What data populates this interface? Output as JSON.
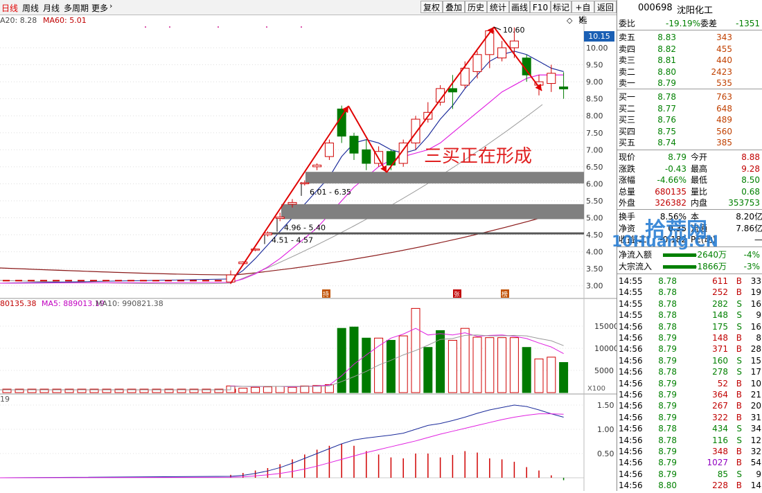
{
  "toolbar": {
    "periods": [
      "日线",
      "周线",
      "月线",
      "多周期",
      "更多"
    ],
    "buttons": [
      "复权",
      "叠加",
      "历史",
      "统计",
      "画线",
      "F10",
      "标记",
      "+自选",
      "返回"
    ]
  },
  "header": {
    "code": "000698",
    "name": "沈阳化工"
  },
  "main_chart": {
    "ma_legend": [
      {
        "text": "A20: 8.28",
        "color": "#4a4a4a"
      },
      {
        "text": "MA60: 5.01",
        "color": "#c00000"
      }
    ],
    "price_box": "10.15",
    "y_ticks": [
      "10.00",
      "9.50",
      "9.00",
      "8.50",
      "8.00",
      "7.50",
      "7.00",
      "6.50",
      "6.00",
      "5.50",
      "5.00",
      "4.50",
      "4.00",
      "3.50",
      "3.00"
    ],
    "peak_label": "10.60",
    "zones": [
      "6.01 - 6.35",
      "4.96 - 5.40",
      "4.51 - 4.57"
    ],
    "annotation": "三买正在形成",
    "markers": [
      "持",
      "张",
      "榜"
    ]
  },
  "vol_chart": {
    "legend": [
      {
        "text": "80135.38",
        "color": "#c00000"
      },
      {
        "text": "MA5: 889013.19",
        "color": "#c000c0"
      },
      {
        "text": "MA10: 990821.38",
        "color": "#555555"
      }
    ],
    "y_ticks": [
      "15000",
      "10000",
      "5000"
    ],
    "scale": "X100"
  },
  "macd_chart": {
    "legend": "19",
    "y_ticks": [
      "1.50",
      "1.00",
      "0.50"
    ]
  },
  "quote": {
    "wei_bi": {
      "label": "委比",
      "value": "-19.19%"
    },
    "wei_cha": {
      "label": "委差",
      "value": "-1351"
    },
    "asks": [
      {
        "label": "卖五",
        "price": "8.83",
        "vol": "343"
      },
      {
        "label": "卖四",
        "price": "8.82",
        "vol": "455"
      },
      {
        "label": "卖三",
        "price": "8.81",
        "vol": "440"
      },
      {
        "label": "卖二",
        "price": "8.80",
        "vol": "2423"
      },
      {
        "label": "卖一",
        "price": "8.79",
        "vol": "535"
      }
    ],
    "bids": [
      {
        "label": "买一",
        "price": "8.78",
        "vol": "763"
      },
      {
        "label": "买二",
        "price": "8.77",
        "vol": "648"
      },
      {
        "label": "买三",
        "price": "8.76",
        "vol": "489"
      },
      {
        "label": "买四",
        "price": "8.75",
        "vol": "560"
      },
      {
        "label": "买五",
        "price": "8.74",
        "vol": "385"
      }
    ],
    "stats": [
      {
        "l1": "现价",
        "v1": "8.79",
        "l2": "今开",
        "v2": "8.88",
        "c1": "#008000",
        "c2": "#c00000"
      },
      {
        "l1": "涨跌",
        "v1": "-0.43",
        "l2": "最高",
        "v2": "9.28",
        "c1": "#008000",
        "c2": "#c00000"
      },
      {
        "l1": "涨幅",
        "v1": "-4.66%",
        "l2": "最低",
        "v2": "8.50",
        "c1": "#008000",
        "c2": "#008000"
      },
      {
        "l1": "总量",
        "v1": "680135",
        "l2": "量比",
        "v2": "0.68",
        "c1": "#c00000",
        "c2": "#008000"
      },
      {
        "l1": "外盘",
        "v1": "326382",
        "l2": "内盘",
        "v2": "353753",
        "c1": "#c00000",
        "c2": "#008000"
      }
    ],
    "stats2": [
      {
        "l1": "换手",
        "v1": "8.56%",
        "l2": "本",
        "v2": "8.20亿"
      },
      {
        "l1": "净资",
        "v1": "0.35",
        "l2": "流通",
        "v2": "7.86亿"
      },
      {
        "l1": "收益(二)",
        "v1": "-0.182",
        "l2": "PE(动)",
        "v2": "—"
      }
    ],
    "flows": [
      {
        "label": "净流入额",
        "value": "-2640万",
        "pct": "-4%"
      },
      {
        "label": "大宗流入",
        "value": "-1866万",
        "pct": "-3%"
      }
    ]
  },
  "ticks": [
    {
      "t": "14:55",
      "p": "8.78",
      "v": "611",
      "d": "B",
      "n": "33"
    },
    {
      "t": "14:55",
      "p": "8.78",
      "v": "252",
      "d": "B",
      "n": "19"
    },
    {
      "t": "14:55",
      "p": "8.78",
      "v": "282",
      "d": "S",
      "n": "16"
    },
    {
      "t": "14:55",
      "p": "8.78",
      "v": "148",
      "d": "S",
      "n": "9"
    },
    {
      "t": "14:56",
      "p": "8.78",
      "v": "175",
      "d": "S",
      "n": "16"
    },
    {
      "t": "14:56",
      "p": "8.79",
      "v": "148",
      "d": "B",
      "n": "8"
    },
    {
      "t": "14:56",
      "p": "8.79",
      "v": "371",
      "d": "B",
      "n": "28"
    },
    {
      "t": "14:56",
      "p": "8.79",
      "v": "160",
      "d": "S",
      "n": "15"
    },
    {
      "t": "14:56",
      "p": "8.78",
      "v": "278",
      "d": "S",
      "n": "17"
    },
    {
      "t": "14:56",
      "p": "8.79",
      "v": "52",
      "d": "B",
      "n": "10"
    },
    {
      "t": "14:56",
      "p": "8.79",
      "v": "364",
      "d": "B",
      "n": "21"
    },
    {
      "t": "14:56",
      "p": "8.79",
      "v": "267",
      "d": "B",
      "n": "20"
    },
    {
      "t": "14:56",
      "p": "8.79",
      "v": "322",
      "d": "B",
      "n": "31"
    },
    {
      "t": "14:56",
      "p": "8.78",
      "v": "434",
      "d": "S",
      "n": "34"
    },
    {
      "t": "14:56",
      "p": "8.78",
      "v": "116",
      "d": "S",
      "n": "12"
    },
    {
      "t": "14:56",
      "p": "8.79",
      "v": "348",
      "d": "B",
      "n": "32"
    },
    {
      "t": "14:56",
      "p": "8.79",
      "v": "1027",
      "d": "B",
      "n": "54"
    },
    {
      "t": "14:56",
      "p": "8.79",
      "v": "85",
      "d": "S",
      "n": "9"
    },
    {
      "t": "14:56",
      "p": "8.80",
      "v": "228",
      "d": "B",
      "n": "14"
    }
  ],
  "watermark": {
    "cn": "拾荒网",
    "en": "10Huang.CN"
  },
  "chart_data": {
    "type": "candlestick",
    "candles": [
      {
        "o": 3.11,
        "c": 3.32,
        "h": 3.45,
        "l": 3.05
      },
      {
        "o": 3.65,
        "c": 3.7,
        "h": 3.72,
        "l": 3.6
      },
      {
        "o": 4.05,
        "c": 4.08,
        "h": 4.1,
        "l": 4.02
      },
      {
        "o": 4.5,
        "c": 4.55,
        "h": 4.6,
        "l": 4.45
      },
      {
        "o": 4.98,
        "c": 5.02,
        "h": 5.15,
        "l": 4.9
      },
      {
        "o": 5.4,
        "c": 5.45,
        "h": 5.55,
        "l": 5.3
      },
      {
        "o": 6.0,
        "c": 6.03,
        "h": 6.1,
        "l": 5.95
      },
      {
        "o": 6.5,
        "c": 6.55,
        "h": 6.6,
        "l": 6.4
      },
      {
        "o": 6.8,
        "c": 7.2,
        "h": 7.3,
        "l": 6.7
      },
      {
        "o": 8.2,
        "c": 7.4,
        "h": 8.3,
        "l": 7.2
      },
      {
        "o": 7.4,
        "c": 6.9,
        "h": 7.5,
        "l": 6.7
      },
      {
        "o": 7.0,
        "c": 6.6,
        "h": 7.3,
        "l": 6.4
      },
      {
        "o": 6.6,
        "c": 6.95,
        "h": 7.1,
        "l": 6.5
      },
      {
        "o": 6.95,
        "c": 6.55,
        "h": 7.0,
        "l": 6.4
      },
      {
        "o": 6.6,
        "c": 7.2,
        "h": 7.3,
        "l": 6.5
      },
      {
        "o": 7.2,
        "c": 7.9,
        "h": 8.0,
        "l": 7.0
      },
      {
        "o": 7.9,
        "c": 8.1,
        "h": 8.4,
        "l": 7.8
      },
      {
        "o": 8.4,
        "c": 8.8,
        "h": 8.9,
        "l": 8.3
      },
      {
        "o": 8.8,
        "c": 8.7,
        "h": 9.2,
        "l": 8.2
      },
      {
        "o": 8.9,
        "c": 9.4,
        "h": 9.6,
        "l": 8.8
      },
      {
        "o": 9.3,
        "c": 9.8,
        "h": 9.9,
        "l": 9.1
      },
      {
        "o": 9.8,
        "c": 10.5,
        "h": 10.55,
        "l": 9.4
      },
      {
        "o": 9.7,
        "c": 10.0,
        "h": 10.2,
        "l": 9.6
      },
      {
        "o": 10.0,
        "c": 10.2,
        "h": 10.6,
        "l": 9.7
      },
      {
        "o": 9.7,
        "c": 9.2,
        "h": 9.8,
        "l": 9.0
      },
      {
        "o": 8.9,
        "c": 9.0,
        "h": 9.2,
        "l": 8.6
      },
      {
        "o": 8.95,
        "c": 9.25,
        "h": 9.5,
        "l": 8.7
      },
      {
        "o": 8.85,
        "c": 8.79,
        "h": 9.28,
        "l": 8.5
      }
    ],
    "volumes": [
      1500,
      1000,
      1200,
      1300,
      1400,
      1200,
      1500,
      1600,
      1800,
      14500,
      14800,
      12300,
      12300,
      11800,
      12800,
      19000,
      10200,
      14000,
      11800,
      14500,
      12500,
      12400,
      12400,
      12400,
      10200,
      7600,
      8000,
      6800
    ],
    "vol_up": [
      true,
      true,
      true,
      true,
      true,
      true,
      true,
      true,
      true,
      false,
      false,
      false,
      true,
      false,
      true,
      true,
      false,
      false,
      true,
      true,
      true,
      true,
      true,
      true,
      false,
      true,
      true,
      false
    ],
    "macd": [
      0.06,
      0.1,
      0.15,
      0.2,
      0.28,
      0.38,
      0.48,
      0.58,
      0.66,
      0.7,
      0.66,
      0.55,
      0.48,
      0.42,
      0.4,
      0.5,
      0.5,
      0.42,
      0.47,
      0.55,
      0.52,
      0.4,
      0.38,
      0.33,
      0.22,
      0.15,
      0.05,
      -0.05
    ]
  }
}
